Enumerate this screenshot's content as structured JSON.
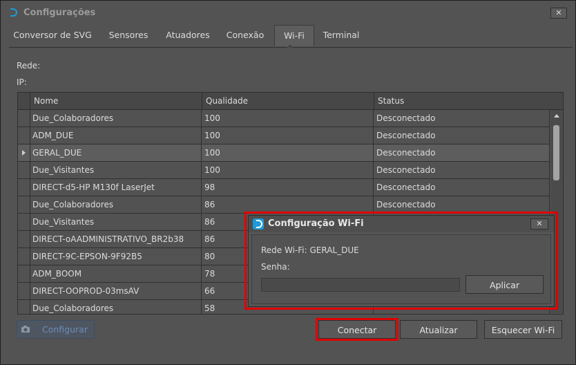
{
  "window": {
    "title": "Configurações",
    "close_label": "✕"
  },
  "tabs": [
    {
      "label": "Conversor de SVG",
      "active": false
    },
    {
      "label": "Sensores",
      "active": false
    },
    {
      "label": "Atuadores",
      "active": false
    },
    {
      "label": "Conexão",
      "active": false
    },
    {
      "label": "Wi-Fi",
      "active": true
    },
    {
      "label": "Terminal",
      "active": false
    }
  ],
  "info": {
    "rede_label": "Rede:",
    "ip_label": "IP:"
  },
  "table": {
    "columns": [
      "Nome",
      "Qualidade",
      "Status"
    ],
    "rows": [
      {
        "name": "Due_Colaboradores",
        "quality": "100",
        "status": "Desconectado"
      },
      {
        "name": "ADM_DUE",
        "quality": "100",
        "status": "Desconectado"
      },
      {
        "name": "GERAL_DUE",
        "quality": "100",
        "status": "Desconectado",
        "selected": true
      },
      {
        "name": "Due_Visitantes",
        "quality": "100",
        "status": "Desconectado"
      },
      {
        "name": "DIRECT-d5-HP M130f LaserJet",
        "quality": "98",
        "status": "Desconectado"
      },
      {
        "name": "Due_Colaboradores",
        "quality": "86",
        "status": "Desconectado"
      },
      {
        "name": "Due_Visitantes",
        "quality": "86",
        "status": ""
      },
      {
        "name": "DIRECT-oAADMINISTRATIVO_BR2b38",
        "quality": "86",
        "status": ""
      },
      {
        "name": "DIRECT-9C-EPSON-9F92B5",
        "quality": "80",
        "status": ""
      },
      {
        "name": "ADM_BOOM",
        "quality": "78",
        "status": ""
      },
      {
        "name": "DIRECT-OOPROD-03msAV",
        "quality": "66",
        "status": ""
      },
      {
        "name": "Due_Colaboradores",
        "quality": "58",
        "status": ""
      }
    ]
  },
  "buttons": {
    "configurar": "Configurar",
    "conectar": "Conectar",
    "atualizar": "Atualizar",
    "esquecer": "Esquecer Wi-Fi"
  },
  "dialog": {
    "title": "Configuração Wi-Fi",
    "close_label": "✕",
    "network_label": "Rede Wi-Fi: GERAL_DUE",
    "password_label": "Senha:",
    "password_value": "",
    "apply_label": "Aplicar"
  },
  "colors": {
    "highlight": "#e00000",
    "accent": "#1d9bd8"
  }
}
